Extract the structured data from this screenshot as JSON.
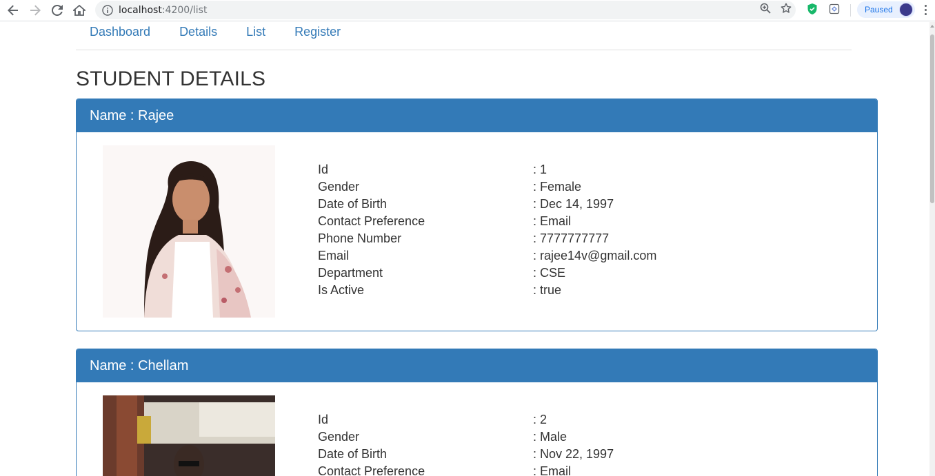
{
  "browser": {
    "url_host": "localhost",
    "url_path": ":4200/list",
    "profile_status": "Paused"
  },
  "nav": {
    "links": [
      "Dashboard",
      "Details",
      "List",
      "Register"
    ]
  },
  "page_title": "STUDENT DETAILS",
  "students": [
    {
      "header": "Name : Rajee",
      "fields": [
        {
          "label": "Id",
          "value": ": 1"
        },
        {
          "label": "Gender",
          "value": ": Female"
        },
        {
          "label": "Date of Birth",
          "value": ": Dec 14, 1997"
        },
        {
          "label": "Contact Preference",
          "value": ": Email"
        },
        {
          "label": "Phone Number",
          "value": ": 7777777777"
        },
        {
          "label": "Email",
          "value": ": rajee14v@gmail.com"
        },
        {
          "label": "Department",
          "value": ": CSE"
        },
        {
          "label": "Is Active",
          "value": ": true"
        }
      ]
    },
    {
      "header": "Name : Chellam",
      "fields": [
        {
          "label": "Id",
          "value": ": 2"
        },
        {
          "label": "Gender",
          "value": ": Male"
        },
        {
          "label": "Date of Birth",
          "value": ": Nov 22, 1997"
        },
        {
          "label": "Contact Preference",
          "value": ": Email"
        }
      ]
    }
  ],
  "colors": {
    "primary": "#337ab7",
    "text": "#333333"
  }
}
